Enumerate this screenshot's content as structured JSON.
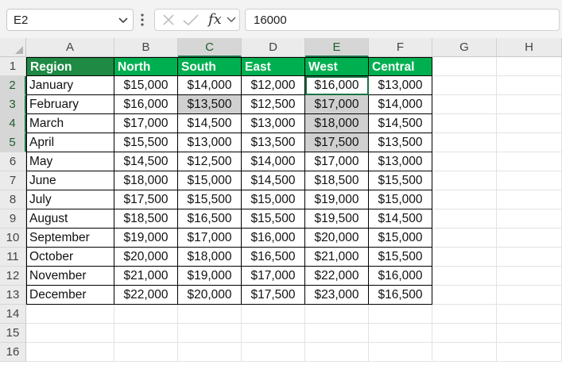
{
  "formula_bar": {
    "name_box": "E2",
    "formula": "16000",
    "fx_label": "fx"
  },
  "columns": [
    "A",
    "B",
    "C",
    "D",
    "E",
    "F",
    "G",
    "H"
  ],
  "rows": [
    "1",
    "2",
    "3",
    "4",
    "5",
    "6",
    "7",
    "8",
    "9",
    "10",
    "11",
    "12",
    "13",
    "14",
    "15",
    "16"
  ],
  "selection": {
    "active_cell": "E2",
    "selected_range": "C3 and E3:E5"
  },
  "colors": {
    "header_fill": "#00b050",
    "selected_header_fill": "#1e8a44",
    "selection_border": "#1a7343",
    "highlight_gray": "#d0d0d0"
  },
  "table": {
    "headers": [
      "Region",
      "North",
      "South",
      "East",
      "West",
      "Central"
    ],
    "rows": [
      [
        "January",
        "$15,000",
        "$14,000",
        "$12,000",
        "$16,000",
        "$13,000"
      ],
      [
        "February",
        "$16,000",
        "$13,500",
        "$12,500",
        "$17,000",
        "$14,000"
      ],
      [
        "March",
        "$17,000",
        "$14,500",
        "$13,000",
        "$18,000",
        "$14,500"
      ],
      [
        "April",
        "$15,500",
        "$13,000",
        "$13,500",
        "$17,500",
        "$13,500"
      ],
      [
        "May",
        "$14,500",
        "$12,500",
        "$14,000",
        "$17,000",
        "$13,000"
      ],
      [
        "June",
        "$18,000",
        "$15,000",
        "$14,500",
        "$18,500",
        "$15,500"
      ],
      [
        "July",
        "$17,500",
        "$15,500",
        "$15,000",
        "$19,000",
        "$15,000"
      ],
      [
        "August",
        "$18,500",
        "$16,500",
        "$15,500",
        "$19,500",
        "$14,500"
      ],
      [
        "September",
        "$19,000",
        "$17,000",
        "$16,000",
        "$20,000",
        "$15,000"
      ],
      [
        "October",
        "$20,000",
        "$18,000",
        "$16,500",
        "$21,000",
        "$15,500"
      ],
      [
        "November",
        "$21,000",
        "$19,000",
        "$17,000",
        "$22,000",
        "$16,000"
      ],
      [
        "December",
        "$22,000",
        "$20,000",
        "$17,500",
        "$23,000",
        "$16,500"
      ]
    ]
  }
}
